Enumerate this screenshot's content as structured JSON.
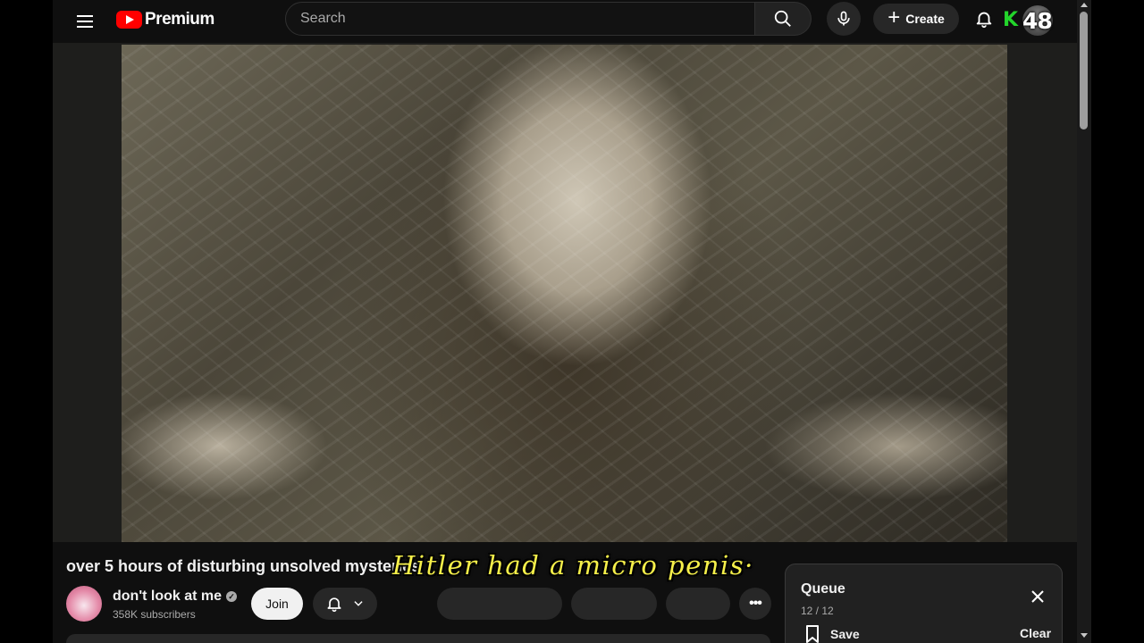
{
  "header": {
    "logo_text": "Premium",
    "search_placeholder": "Search",
    "create_label": "Create",
    "k_icon_text": "K",
    "avatar_badge": "48"
  },
  "player": {
    "subtitle_text": "Hitler had a micro penis·"
  },
  "video": {
    "title": "over 5 hours of disturbing unsolved mysteries",
    "channel_name": "don't look at me",
    "subscribers": "358K subscribers",
    "join_label": "Join"
  },
  "queue": {
    "title": "Queue",
    "count": "12 / 12",
    "save_label": "Save",
    "clear_label": "Clear"
  },
  "colors": {
    "background": "#0f0f0f",
    "brand_red": "#ff0000",
    "subtitle_yellow": "#f6f04a",
    "k_icon_green": "#23d52b"
  },
  "icons": [
    "menu-icon",
    "youtube-logo-icon",
    "search-icon",
    "microphone-icon",
    "plus-icon",
    "bell-icon",
    "verified-icon",
    "chevron-down-icon",
    "more-icon",
    "close-icon",
    "bookmark-icon"
  ]
}
